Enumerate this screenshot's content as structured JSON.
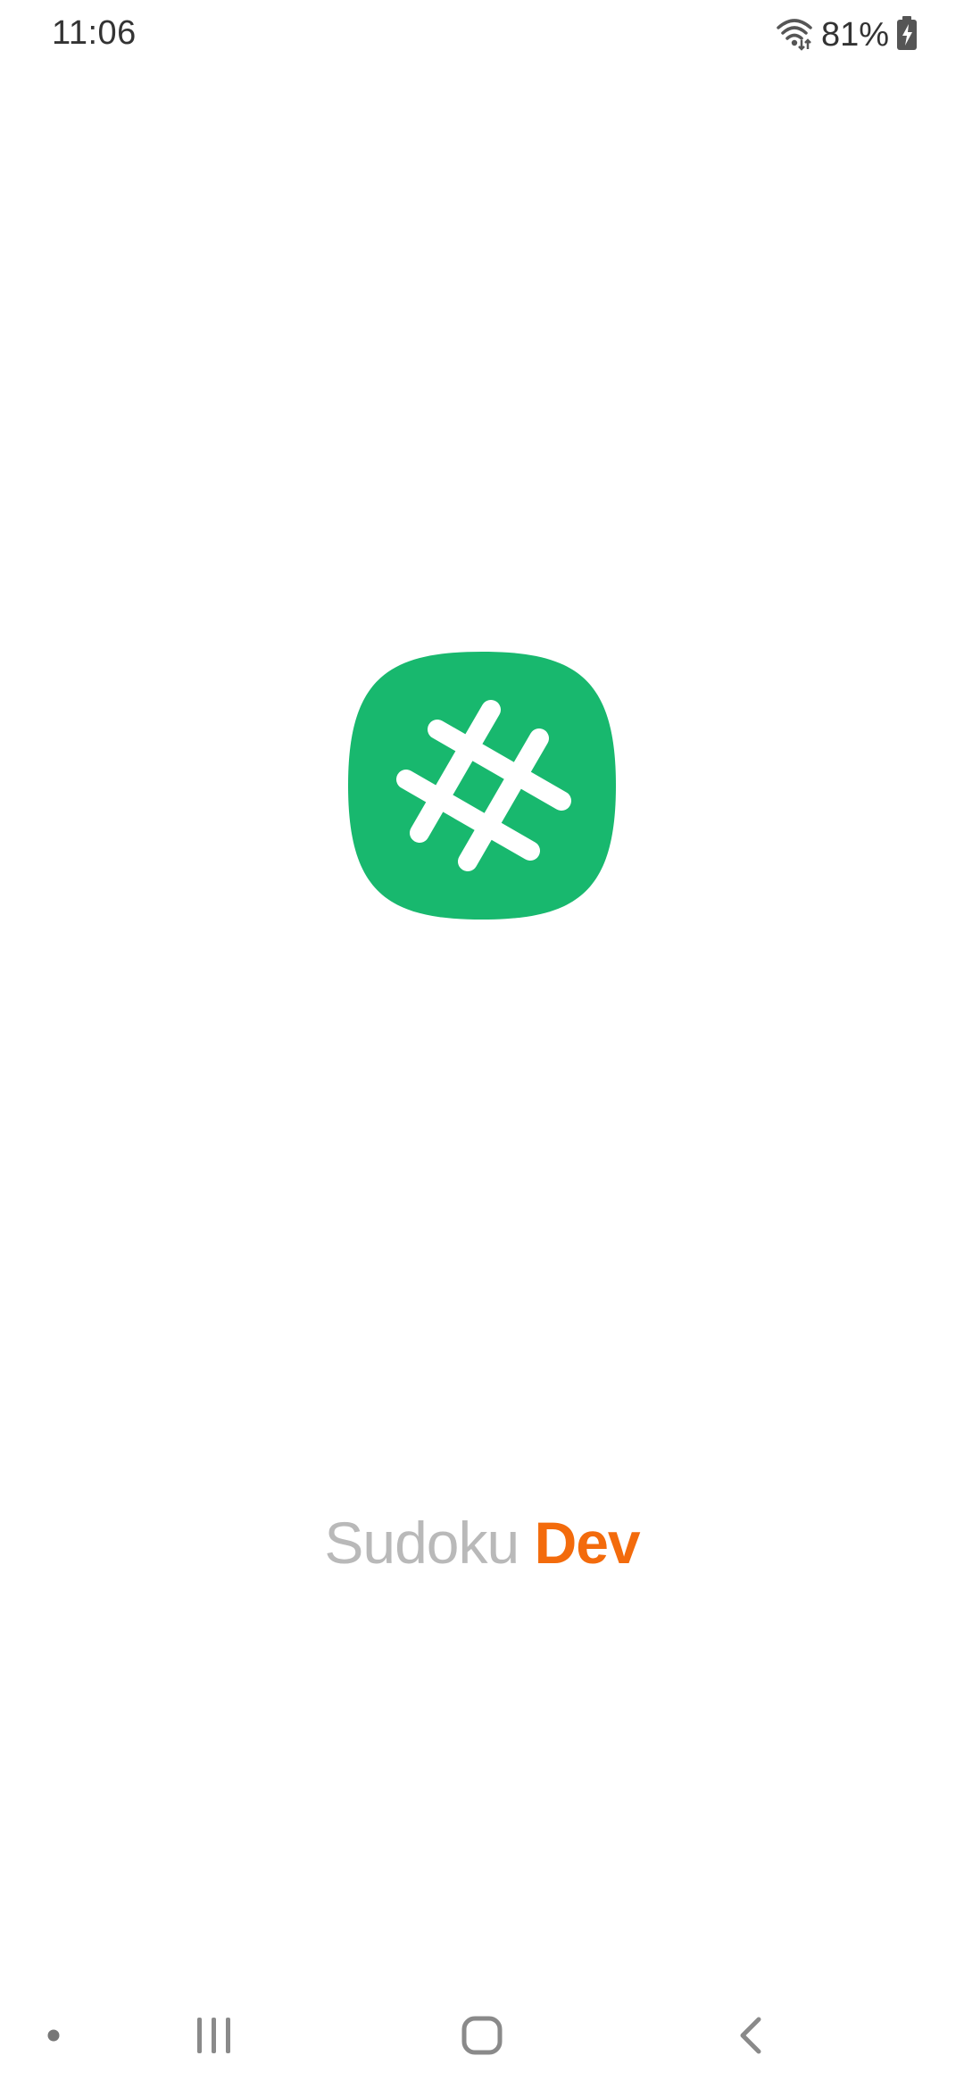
{
  "status_bar": {
    "time": "11:06",
    "battery_percent": "81%",
    "wifi_icon": "wifi-icon",
    "battery_icon": "battery-charging-icon"
  },
  "splash": {
    "app_icon": "hash-grid-icon",
    "app_icon_color": "#18b86e",
    "app_name_part1": "Sudoku",
    "app_name_part2": "Dev",
    "app_name_part1_color": "#b9b9b9",
    "app_name_part2_color": "#f36b0c"
  },
  "nav_bar": {
    "items": [
      {
        "icon": "dot-icon"
      },
      {
        "icon": "recent-apps-icon"
      },
      {
        "icon": "home-icon"
      },
      {
        "icon": "back-icon"
      }
    ]
  }
}
